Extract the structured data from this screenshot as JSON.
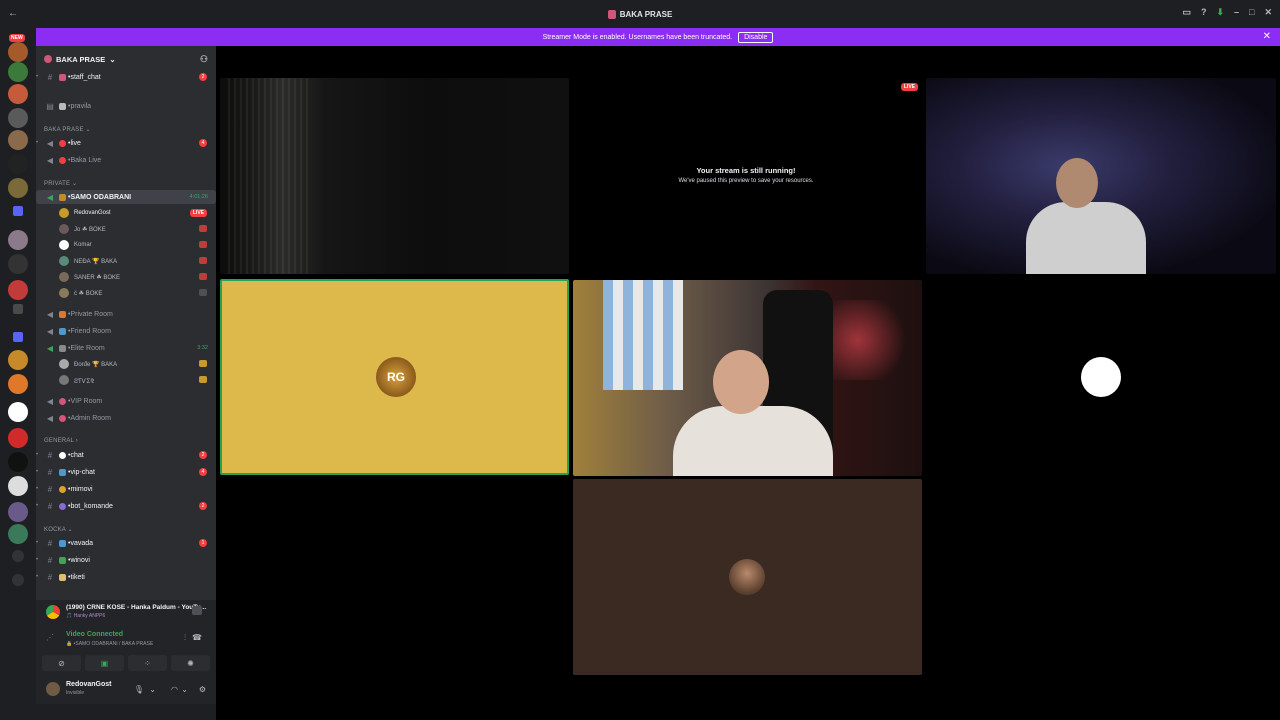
{
  "window": {
    "title": "BAKA PRASE"
  },
  "banner": {
    "text": "Streamer Mode is enabled. Usernames have been truncated.",
    "button": "Disable"
  },
  "rail": {
    "new_badge": "NEW"
  },
  "guild": {
    "name": "BAKA PRASE"
  },
  "channels_top": [
    {
      "name": "•staff_chat",
      "count": "2"
    },
    {
      "name": "•pravila"
    }
  ],
  "categories": {
    "baka": "BAKA PRASE",
    "private": "PRIVATE",
    "general": "GENERAL",
    "kocka": "KOCKA"
  },
  "baka_channels": [
    {
      "name": "•live",
      "count": "4"
    },
    {
      "name": "•Baka Live"
    }
  ],
  "private_channels": {
    "samo": {
      "name": "•SAMO ODABRANI",
      "time": "4:01:26"
    },
    "members": [
      {
        "name": "RedovanGost",
        "badge": "LIVE"
      },
      {
        "name": "Jo  ☘ BOKE"
      },
      {
        "name": "Komar"
      },
      {
        "name": "NEĐA  🏆 BAKA"
      },
      {
        "name": "SANER  ☘ BOKE"
      },
      {
        "name": "ć  ☘ BOKE"
      }
    ],
    "private_room": "•Private Room",
    "friend_room": "•Friend Room",
    "elite_room": {
      "name": "•Elite Room",
      "time": "3:32"
    },
    "elite_members": [
      {
        "name": "Đorđe  🏆 BAKA"
      },
      {
        "name": "ƧƬѴΣ⅊"
      }
    ],
    "vip_room": "•VIP Room",
    "admin_room": "•Admin Room"
  },
  "general_channels": [
    {
      "name": "•chat",
      "count": "2"
    },
    {
      "name": "•vip-chat",
      "count": "4"
    },
    {
      "name": "•mimovi"
    },
    {
      "name": "•bot_komande",
      "count": "2"
    }
  ],
  "kocka_channels": [
    {
      "name": "•vavada",
      "count": "1"
    },
    {
      "name": "•winovi"
    },
    {
      "name": "•tiketi"
    }
  ],
  "activity": {
    "title": "(1990) CRNE KOSE - Hanka Paldum - YouTu...",
    "sub": "🎵 Hanky ANPP6"
  },
  "voice": {
    "status": "Video Connected",
    "path": "🔒 •SAMO ODABRANI / BAKA PRASE"
  },
  "user": {
    "name": "RedovanGost",
    "status": "Invisible"
  },
  "stream": {
    "live": "LIVE",
    "title": "Your stream is still running!",
    "sub": "We've paused this preview to save your resources.",
    "logo": "RG"
  }
}
